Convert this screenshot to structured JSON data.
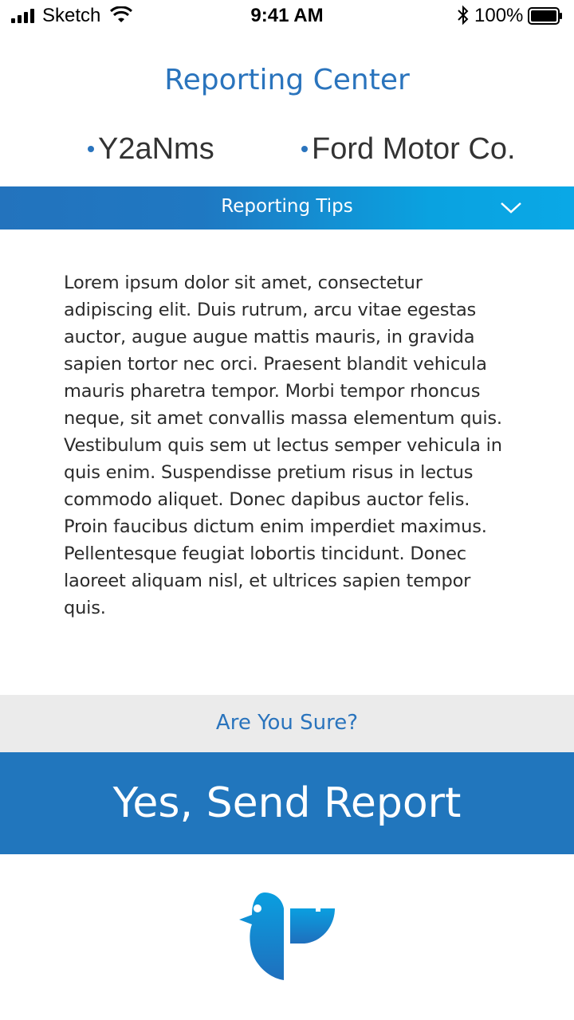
{
  "status_bar": {
    "carrier": "Sketch",
    "time": "9:41 AM",
    "battery_percent": "100%",
    "icons": [
      "signal-icon",
      "wifi-icon",
      "bluetooth-icon",
      "battery-icon"
    ]
  },
  "header": {
    "title": "Reporting Center"
  },
  "parties": [
    {
      "name": "Y2aNms"
    },
    {
      "name": "Ford Motor Co."
    }
  ],
  "tips": {
    "label": "Reporting Tips",
    "icon": "chevron-down-icon",
    "body": "Lorem ipsum dolor sit amet, consectetur adipiscing elit. Duis rutrum, arcu vitae egestas auctor, augue augue mattis mauris, in gravida sapien tortor nec orci. Praesent blandit vehicula mauris pharetra tempor. Morbi tempor rhoncus neque, sit amet convallis massa elementum quis. Vestibulum quis sem ut lectus semper vehicula in quis enim. Suspendisse pretium risus in lectus commodo aliquet. Donec dapibus auctor felis. Proin faucibus dictum enim imperdiet maximus. Pellentesque feugiat lobortis tincidunt. Donec laoreet aliquam nisl, et ultrices sapien tempor quis."
  },
  "confirm": {
    "question": "Are You Sure?",
    "button_label": "Yes, Send Report"
  },
  "footer": {
    "logo_icon": "bird-logo-icon"
  },
  "colors": {
    "accent": "#2a74bd",
    "button": "#2176bd",
    "gradient_end": "#0aa8e6",
    "confirm_bg": "#ebebeb"
  }
}
